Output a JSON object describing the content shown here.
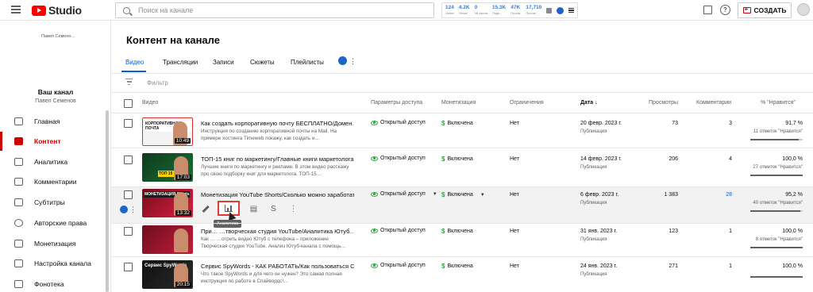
{
  "app": {
    "name": "Studio"
  },
  "search": {
    "placeholder": "Поиск на канале"
  },
  "stats_widget": [
    {
      "value": "124",
      "label": "Views"
    },
    {
      "value": "4.2K",
      "label": "Views"
    },
    {
      "value": "0",
      "label": "48 часов"
    },
    {
      "value": "15.3K",
      "label": "Подп."
    },
    {
      "value": "47K",
      "label": "Просм."
    },
    {
      "value": "17,710",
      "label": "Просм."
    }
  ],
  "header": {
    "create_label": "СОЗДАТЬ"
  },
  "sidebar": {
    "top_name": "Павел Семено…",
    "channel_label": "Ваш канал",
    "channel_name": "Павел Семенов",
    "items": [
      {
        "label": "Главная",
        "icon": "dashboard-icon"
      },
      {
        "label": "Контент",
        "icon": "content-icon",
        "active": true
      },
      {
        "label": "Аналитика",
        "icon": "analytics-icon"
      },
      {
        "label": "Комментарии",
        "icon": "comments-icon"
      },
      {
        "label": "Субтитры",
        "icon": "subtitles-icon"
      },
      {
        "label": "Авторские права",
        "icon": "copyright-icon"
      },
      {
        "label": "Монетизация",
        "icon": "dollar-icon"
      },
      {
        "label": "Настройка канала",
        "icon": "magic-icon"
      },
      {
        "label": "Фонотека",
        "icon": "audio-library-icon"
      }
    ]
  },
  "page": {
    "title": "Контент на канале"
  },
  "tabs": [
    {
      "label": "Видео",
      "active": true
    },
    {
      "label": "Трансляции"
    },
    {
      "label": "Записи"
    },
    {
      "label": "Сюжеты"
    },
    {
      "label": "Плейлисты"
    }
  ],
  "filter": {
    "placeholder": "Фильтр"
  },
  "table": {
    "columns": {
      "video": "Видео",
      "visibility": "Параметры доступа",
      "monetization": "Монетизация",
      "restrictions": "Ограничения",
      "date": "Дата ↓",
      "views": "Просмотры",
      "comments": "Комментарии",
      "likes": "% \"Нравится\""
    },
    "rows": [
      {
        "title": "Как создать корпоративную почту БЕСПЛАТНО/Домен…",
        "desc": "Инструкция по созданию корпоративной почты на Mail. На примере хостинга Timeweb покажу, как создать и…",
        "duration": "10:49",
        "thumb_tag": "КОРПОРАТИВНАЯ ПОЧТА",
        "visibility": "Открытый доступ",
        "monetization": "Включена",
        "restrictions": "Нет",
        "date": "20 февр. 2023 г.",
        "status": "Публикация",
        "views": "73",
        "comments": "3",
        "likes": "91,7 %",
        "likes_sub": "11 отметок \"Нравится\"",
        "like_ratio": 0.917
      },
      {
        "title": "ТОП-15 книг по маркетингу/Главные книги маркетолога",
        "desc": "Лучшие книги по маркетингу и рекламе. В этом видео расскажу про свою подборку книг для маркетолога. ТОП-15…",
        "duration": "17:03",
        "thumb_tag": "ТОП 15 КН",
        "visibility": "Открытый доступ",
        "monetization": "Включена",
        "restrictions": "Нет",
        "date": "14 февр. 2023 г.",
        "status": "Публикация",
        "views": "206",
        "comments": "4",
        "likes": "100,0 %",
        "likes_sub": "27 отметок \"Нравится\"",
        "like_ratio": 1.0
      },
      {
        "title": "Монетизация YouTube Shorts/Сколько можно заработат…",
        "desc": "",
        "duration": "13:32",
        "thumb_tag": "МОНЕТИЗАЦИЯ Shorts",
        "visibility": "Открытый доступ",
        "monetization": "Включена",
        "restrictions": "Нет",
        "date": "6 февр. 2023 г.",
        "status": "Публикация",
        "views": "1 383",
        "comments": "28",
        "likes": "95,2 %",
        "likes_sub": "40 отметок \"Нравится\"",
        "like_ratio": 0.952
      },
      {
        "title": "При… …творческая студия YouTube/Аналитика Ютуб…",
        "desc": "Как … …отреть видео Ютуб с телефона – приложение Творческая студия YouTube. Анализ Ютуб-канала с помощь…",
        "duration": "",
        "thumb_tag": "",
        "visibility": "Открытый доступ",
        "monetization": "Включена",
        "restrictions": "Нет",
        "date": "31 янв. 2023 г.",
        "status": "Публикация",
        "views": "123",
        "comments": "1",
        "likes": "100,0 %",
        "likes_sub": "8 отметок \"Нравится\"",
        "like_ratio": 1.0
      },
      {
        "title": "Сервис SpyWords - КАК РАБОТАТЬ/Как пользоваться СП…",
        "desc": "Что такое SpyWords и для чего он нужен? Это самая полная инструкция по работе в Спайвордс!…",
        "duration": "20:15",
        "thumb_tag": "Сервис SpyWords",
        "visibility": "Открытый доступ",
        "monetization": "Включена",
        "restrictions": "Нет",
        "date": "24 янв. 2023 г.",
        "status": "Публикация",
        "views": "271",
        "comments": "1",
        "likes": "100,0 %",
        "likes_sub": "",
        "like_ratio": 1.0
      }
    ]
  },
  "tooltip": {
    "label": "Аналитика"
  }
}
